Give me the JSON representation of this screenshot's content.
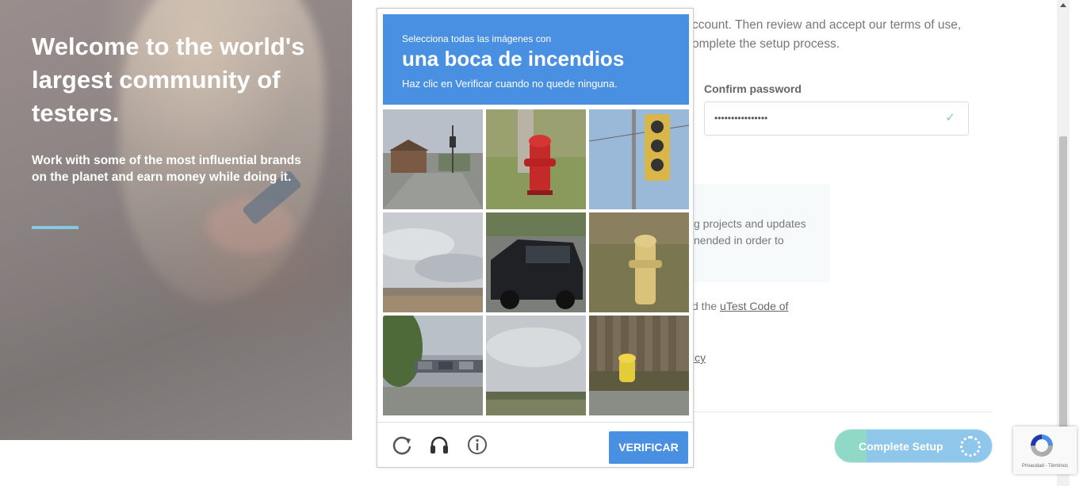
{
  "hero": {
    "title": "Welcome to the world's largest community of testers.",
    "subtitle": "Work with some of the most influential brands on the planet and earn money while doing it."
  },
  "form": {
    "intro_line1": "ccount. Then review and accept our terms of use,",
    "intro_line2": "omplete the setup process.",
    "confirm_password_label": "Confirm password",
    "confirm_password_value": "••••••••••••••••",
    "info_line1": "g projects and updates",
    "info_line2": "nended in order to",
    "code_prefix": "d the ",
    "code_link": "uTest Code of",
    "policy_link": "icy",
    "complete_button": "Complete Setup"
  },
  "captcha": {
    "instruction_small": "Selecciona todas las imágenes con",
    "instruction_big": "una boca de incendios",
    "instruction_hint": "Haz clic en Verificar cuando no quede ninguna.",
    "verify_label": "VERIFICAR",
    "accent_color": "#4a90e2",
    "tiles": [
      {
        "content": "street-intersection"
      },
      {
        "content": "red-fire-hydrant"
      },
      {
        "content": "traffic-light"
      },
      {
        "content": "cloudy-sky-overpass"
      },
      {
        "content": "black-pickup-truck"
      },
      {
        "content": "yellow-fire-hydrant"
      },
      {
        "content": "parking-lot-trees"
      },
      {
        "content": "cloudy-sky-road"
      },
      {
        "content": "yellow-fire-hydrant-fence"
      }
    ]
  },
  "recaptcha_badge": {
    "terms": "Privacidad - Términos"
  }
}
